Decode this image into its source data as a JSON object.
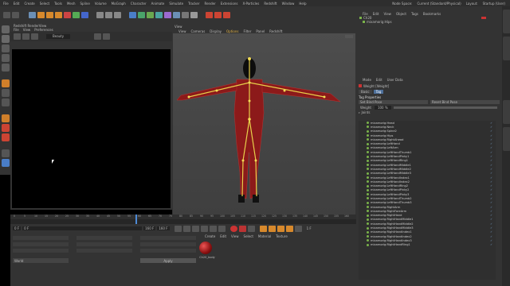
{
  "menubar": {
    "items": [
      "File",
      "Edit",
      "Create",
      "Select",
      "Tools",
      "Mesh",
      "Spline",
      "Volume",
      "MoGraph",
      "Character",
      "Animate",
      "Simulate",
      "Tracker",
      "Render",
      "Extensions",
      "X-Particles",
      "Redshift",
      "Window",
      "Help"
    ],
    "right": [
      "Node Space:",
      "Current (Standard/Physical)",
      "Layout:",
      "Startup (User)"
    ]
  },
  "left_panel": {
    "title": "Redshift RenderView",
    "menu": [
      "File",
      "View",
      "Preferences"
    ],
    "beauty": "Beauty"
  },
  "viewport": {
    "label": "View",
    "menu": [
      "View",
      "Cameras",
      "Display",
      "Options",
      "Filter",
      "Panel",
      "Redshift"
    ]
  },
  "objects": {
    "menu": [
      "File",
      "Edit",
      "View",
      "Object",
      "Tags",
      "Bookmarks"
    ],
    "items": [
      "Ch20",
      "mixamorig:Hips"
    ]
  },
  "attributes": {
    "menu": [
      "Mode",
      "Edit",
      "User Data"
    ],
    "title": "Weight [Weight]",
    "tabs": [
      "Basic",
      "Tag"
    ],
    "section": "Tag Properties",
    "set_bind_pose": "Set Bind Pose",
    "reset_bind_pose": "Reset Bind Pose",
    "weight_label": "Weight",
    "weight_value": "100 %",
    "joints_label": "Joints",
    "joints": [
      "mixamorig:Head",
      "mixamorig:Neck",
      "mixamorig:Spine2",
      "mixamorig:Hips",
      "mixamorig:RightAhead",
      "mixamorig:LeftHand",
      "mixamorig:LeftArm",
      "mixamorig:LeftHandThumb1",
      "mixamorig:LeftHandPinky1",
      "mixamorig:LeftHandRing1",
      "mixamorig:LeftHandMiddle1",
      "mixamorig:LeftHandMiddle2",
      "mixamorig:LeftHandMiddle3",
      "mixamorig:LeftHandIndex1",
      "mixamorig:LeftHandIndex2",
      "mixamorig:LeftHandRing2",
      "mixamorig:LeftHandPinky2",
      "mixamorig:LeftHandPinky3",
      "mixamorig:LeftHandThumb2",
      "mixamorig:LeftHandThumb3",
      "mixamorig:RightArm",
      "mixamorig:RightForeArm",
      "mixamorig:RightHand",
      "mixamorig:RightHandMiddle1",
      "mixamorig:RightHandMiddle2",
      "mixamorig:RightHandMiddle3",
      "mixamorig:RightHandIndex1",
      "mixamorig:RightHandIndex2",
      "mixamorig:RightHandIndex3",
      "mixamorig:RightHandRing1"
    ]
  },
  "timeline": {
    "ticks": [
      "0",
      "5",
      "10",
      "15",
      "20",
      "25",
      "30",
      "35",
      "40",
      "45",
      "50",
      "55",
      "60",
      "65",
      "70",
      "75",
      "80",
      "85",
      "90",
      "95",
      "100",
      "105",
      "110",
      "115",
      "120",
      "125",
      "130",
      "135",
      "140",
      "145",
      "150",
      "155",
      "160"
    ],
    "frame_start": "0 F",
    "frame_mid": "0 F",
    "frame_end": "160 F",
    "frame_end2": "160 F",
    "current": "1 F"
  },
  "material_manager": {
    "menu": [
      "Create",
      "Edit",
      "View",
      "Select",
      "Material",
      "Texture"
    ],
    "material_name": "Ch20_body"
  },
  "coords": {
    "apply": "Apply",
    "world": "World"
  }
}
